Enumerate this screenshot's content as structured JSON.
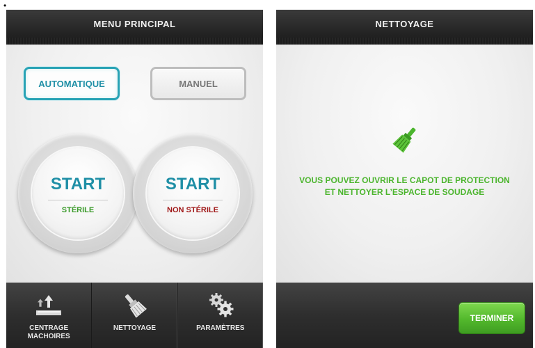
{
  "stray_mark": "•",
  "left_screen": {
    "header_title": "MENU PRINCIPAL",
    "mode_buttons": {
      "automatic": "AUTOMATIQUE",
      "manual": "MANUEL"
    },
    "start_buttons": [
      {
        "label": "START",
        "sub_label": "STÉRILE",
        "color": "#3a9a2a"
      },
      {
        "label": "START",
        "sub_label": "NON STÉRILE",
        "color": "#a01818"
      }
    ],
    "footer_items": [
      {
        "label": "CENTRAGE MACHOIRES",
        "icon": "jaw-centering-icon"
      },
      {
        "label": "NETTOYAGE",
        "icon": "brush-icon"
      },
      {
        "label": "PARAMÈTRES",
        "icon": "gears-icon"
      }
    ]
  },
  "right_screen": {
    "header_title": "NETTOYAGE",
    "icon": "brush-icon",
    "message_line1": "VOUS POUVEZ OUVRIR LE CAPOT DE PROTECTION",
    "message_line2": "ET NETTOYER L’ESPACE DE SOUDAGE",
    "finish_button": "TERMINER"
  },
  "colors": {
    "accent_blue": "#29a3b5",
    "success_green": "#4cb52e",
    "danger_red": "#a01818"
  }
}
